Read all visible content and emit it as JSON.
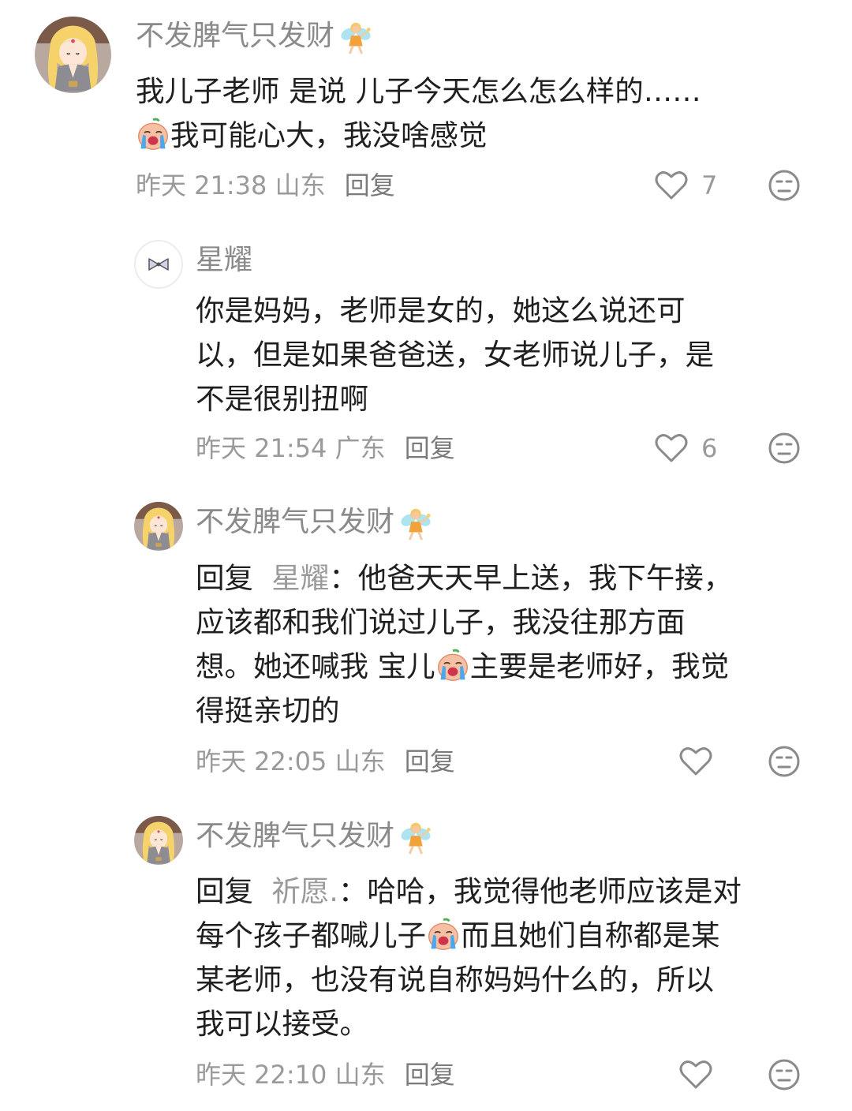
{
  "comments": [
    {
      "username": "不发脾气只发财",
      "lines": [
        "我儿子老师 是说 儿子今天怎么怎么样的……",
        "我可能心大，我没啥感觉"
      ],
      "time": "昨天 21:38",
      "location": "山东",
      "reply_label": "回复",
      "likes": "7"
    },
    {
      "username": "星耀",
      "lines": [
        "你是妈妈，老师是女的，她这么说还可",
        "以，但是如果爸爸送，女老师说儿子，是",
        "不是很别扭啊"
      ],
      "time": "昨天 21:54",
      "location": "广东",
      "reply_label": "回复",
      "likes": "6"
    },
    {
      "username": "不发脾气只发财",
      "reply_prefix": "回复",
      "reply_target": "星耀",
      "reply_colon": "：",
      "lines": [
        "他爸天天早上送，我下午接，",
        "应该都和我们说过儿子，我没往那方面",
        "想。她还喊我 宝儿",
        "主要是老师好，我觉",
        "得挺亲切的"
      ],
      "time": "昨天 22:05",
      "location": "山东",
      "reply_label": "回复"
    },
    {
      "username": "不发脾气只发财",
      "reply_prefix": "回复",
      "reply_target": "祈愿.",
      "reply_colon": "：",
      "lines": [
        "哈哈，我觉得他老师应该是对",
        "每个孩子都喊儿子",
        "而且她们自称都是某",
        "某老师，也没有说自称妈妈什么的，所以",
        "我可以接受。"
      ],
      "time": "昨天 22:10",
      "location": "山东",
      "reply_label": "回复"
    }
  ],
  "icons": {
    "fairy": "fairy-emoji-icon",
    "crying": "crying-face-emoji-icon",
    "like": "heart-outline-icon",
    "dislike": "unamused-face-icon",
    "bow": "bow-icon"
  },
  "colors": {
    "username": "#8a8a8a",
    "text": "#1f1f1f",
    "meta": "#9a9a9a"
  }
}
